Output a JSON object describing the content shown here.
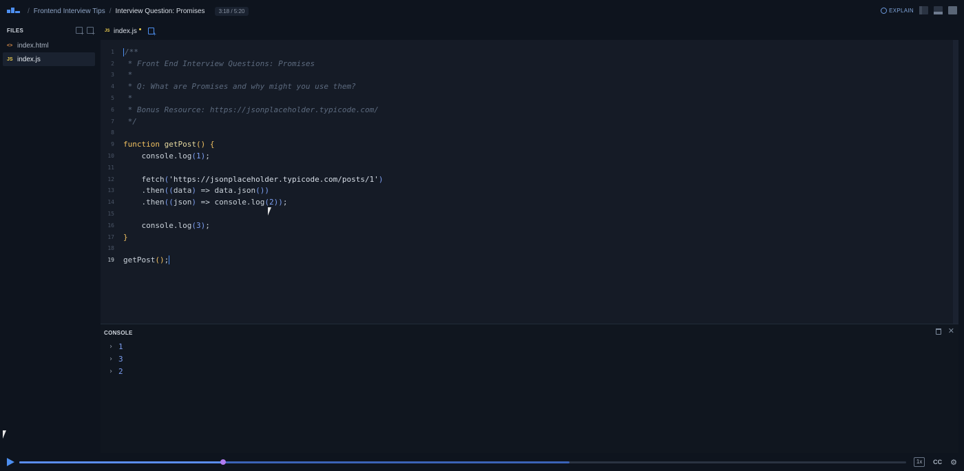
{
  "topbar": {
    "breadcrumb": [
      {
        "label": "Frontend Interview Tips"
      },
      {
        "label": "Interview Question: Promises"
      }
    ],
    "time": "3:18 / 5:20",
    "explain_label": "EXPLAIN"
  },
  "sidebar": {
    "header": "FILES",
    "files": [
      {
        "name": "index.html",
        "icon": "html-file-icon",
        "active": false
      },
      {
        "name": "index.js",
        "icon": "js-file-icon",
        "active": true
      }
    ]
  },
  "editor": {
    "tab_label": "index.js",
    "tab_icon_label": "JS",
    "line_numbers": [
      "1",
      "2",
      "3",
      "4",
      "5",
      "6",
      "7",
      "8",
      "9",
      "10",
      "11",
      "12",
      "13",
      "14",
      "15",
      "16",
      "17",
      "18",
      "19"
    ],
    "lines": [
      [
        {
          "t": "/**",
          "c": "cmt"
        }
      ],
      [
        {
          "t": " * Front End Interview Questions: Promises",
          "c": "cmt"
        }
      ],
      [
        {
          "t": " *",
          "c": "cmt"
        }
      ],
      [
        {
          "t": " * Q: What are Promises and why might you use them?",
          "c": "cmt"
        }
      ],
      [
        {
          "t": " *",
          "c": "cmt"
        }
      ],
      [
        {
          "t": " * Bonus Resource: https://jsonplaceholder.typicode.com/",
          "c": "cmt"
        }
      ],
      [
        {
          "t": " */",
          "c": "cmt"
        }
      ],
      [],
      [
        {
          "t": "function",
          "c": "kw"
        },
        {
          "t": " getPost",
          "c": "fn"
        },
        {
          "t": "()",
          "c": "br"
        },
        {
          "t": " {",
          "c": "br"
        }
      ],
      [
        {
          "t": "    console.log",
          "c": "id"
        },
        {
          "t": "(",
          "c": "br2"
        },
        {
          "t": "1",
          "c": "num"
        },
        {
          "t": ")",
          "c": "br2"
        },
        {
          "t": ";",
          "c": "id"
        }
      ],
      [],
      [
        {
          "t": "    fetch",
          "c": "id"
        },
        {
          "t": "(",
          "c": "br2"
        },
        {
          "t": "'https://jsonplaceholder.typicode.com/posts/1'",
          "c": "str"
        },
        {
          "t": ")",
          "c": "br2"
        }
      ],
      [
        {
          "t": "    .then",
          "c": "id"
        },
        {
          "t": "((",
          "c": "br2"
        },
        {
          "t": "data",
          "c": "id"
        },
        {
          "t": ")",
          "c": "br2"
        },
        {
          "t": " => data.json",
          "c": "id"
        },
        {
          "t": "())",
          "c": "br2"
        }
      ],
      [
        {
          "t": "    .then",
          "c": "id"
        },
        {
          "t": "((",
          "c": "br2"
        },
        {
          "t": "json",
          "c": "id"
        },
        {
          "t": ")",
          "c": "br2"
        },
        {
          "t": " => console.log",
          "c": "id"
        },
        {
          "t": "(",
          "c": "br2"
        },
        {
          "t": "2",
          "c": "num"
        },
        {
          "t": "))",
          "c": "br2"
        },
        {
          "t": ";",
          "c": "id"
        }
      ],
      [],
      [
        {
          "t": "    console.log",
          "c": "id"
        },
        {
          "t": "(",
          "c": "br2"
        },
        {
          "t": "3",
          "c": "num"
        },
        {
          "t": ")",
          "c": "br2"
        },
        {
          "t": ";",
          "c": "id"
        }
      ],
      [
        {
          "t": "}",
          "c": "br"
        }
      ],
      [],
      [
        {
          "t": "getPost",
          "c": "id"
        },
        {
          "t": "()",
          "c": "br"
        },
        {
          "t": ";",
          "c": "id"
        }
      ]
    ],
    "current_line": 19
  },
  "console": {
    "title": "CONSOLE",
    "logs": [
      "1",
      "3",
      "2"
    ]
  },
  "player": {
    "progress": 0.23,
    "buffered": 0.62,
    "cc_label": "CC",
    "speed_label": "1x"
  },
  "colors": {
    "accent": "#4d8ff0",
    "thumb": "#b07bf0",
    "keyword": "#f0c060",
    "number": "#7c9ef0"
  }
}
